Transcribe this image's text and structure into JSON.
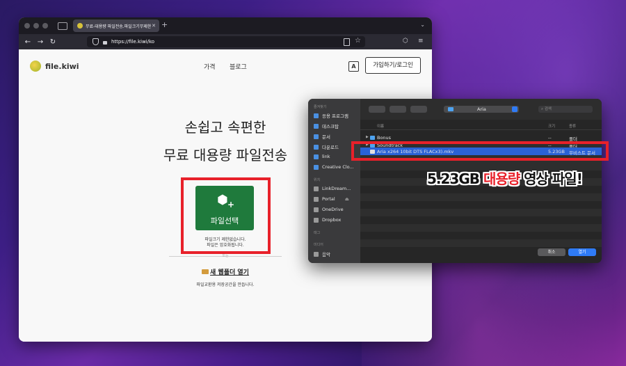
{
  "browser": {
    "tab_title": "무료-대용량 파일전송.파일크기무제한",
    "url": "https://file.kiwi/ko"
  },
  "site": {
    "logo_text": "file.kiwi",
    "menu": [
      "가격",
      "블로그"
    ],
    "translate_icon_text": "A",
    "login_button": "가입하기/로그인",
    "hero_line1": "손쉽고 속편한",
    "hero_line2": "무료 대용량 파일전송",
    "upload_button": "파일선택",
    "upload_note_line1": "파일크기 제한없습니다.",
    "upload_note_line2": "파일은 암호화됩니다.",
    "divider_text": "또는",
    "new_folder_link": "새 웹폴더 열기",
    "new_folder_note": "파일교환용 저장공간을 만듭니다."
  },
  "finder": {
    "sidebar_sections": [
      {
        "title": "즐겨찾기",
        "items": [
          {
            "label": "응용 프로그램",
            "icon": "apps-icon"
          },
          {
            "label": "데스크탑",
            "icon": "desktop-icon"
          },
          {
            "label": "문서",
            "icon": "document-icon"
          },
          {
            "label": "다운로드",
            "icon": "download-icon"
          },
          {
            "label": "link",
            "icon": "folder-icon"
          },
          {
            "label": "Creative Clo...",
            "icon": "document-icon"
          }
        ]
      },
      {
        "title": "위치",
        "items": [
          {
            "label": "LinkDream...",
            "icon": "display-icon"
          },
          {
            "label": "Portal",
            "icon": "drive-icon"
          },
          {
            "label": "OneDrive",
            "icon": "cloud-icon"
          },
          {
            "label": "Dropbox",
            "icon": "dropbox-icon"
          }
        ]
      },
      {
        "title": "태그",
        "items": []
      },
      {
        "title": "미디어",
        "items": [
          {
            "label": "음악",
            "icon": "music-icon"
          }
        ]
      }
    ],
    "path_label": "Aria",
    "search_placeholder": "검색",
    "columns": {
      "name": "이름",
      "size": "크기",
      "kind": "종류"
    },
    "rows": [
      {
        "name": "Bonus",
        "size": "--",
        "kind": "폴더",
        "folder": true
      },
      {
        "name": "Soundtrack",
        "size": "--",
        "kind": "폴더",
        "folder": true
      },
      {
        "name": "Aria                    x264 10bit DTS FLACx3).mkv",
        "size": "5.23GB",
        "kind": "무비스트 문서",
        "selected": true
      }
    ],
    "cancel_button": "취소",
    "open_button": "열기"
  },
  "caption": {
    "part1": "5.23GB ",
    "part2": "대용량",
    "part3": " 영상 파일!"
  }
}
